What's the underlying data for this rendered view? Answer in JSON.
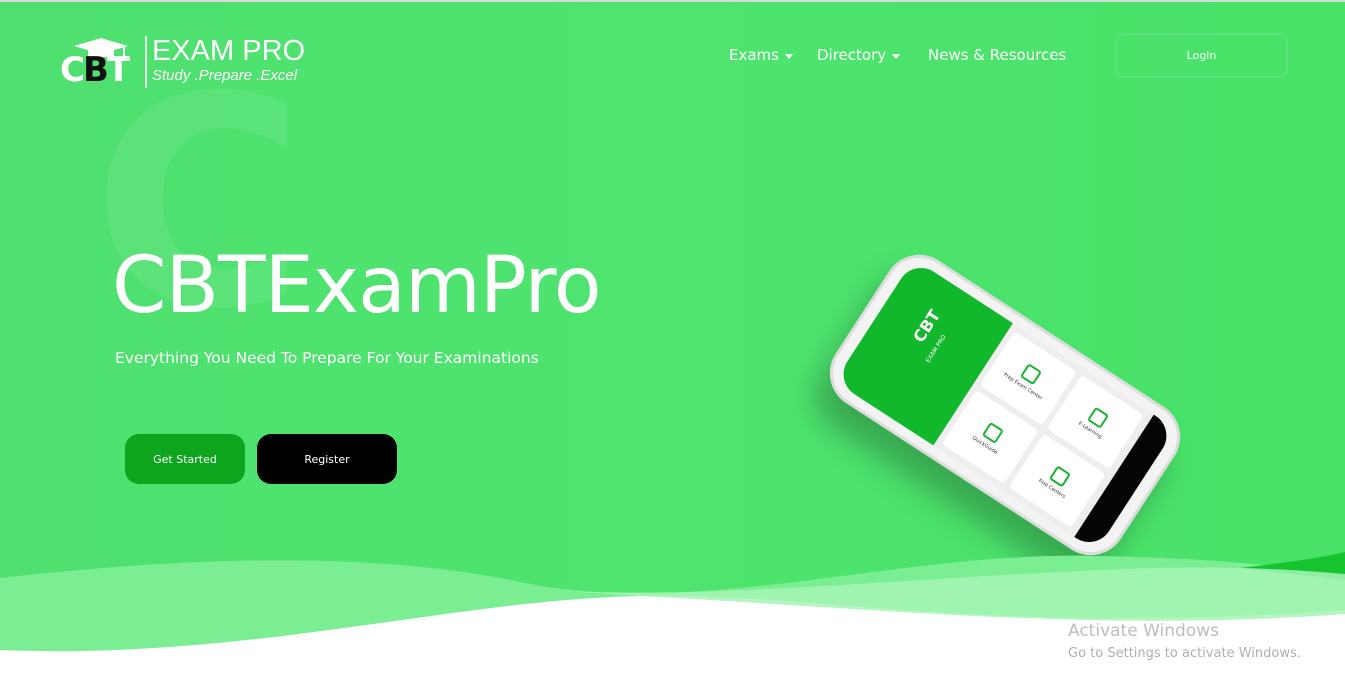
{
  "logo": {
    "mark": {
      "c": "C",
      "b": "B",
      "t": "T"
    },
    "title": "EXAM PRO",
    "tagline": "Study .Prepare .Excel"
  },
  "nav": {
    "exams": "Exams",
    "directory": "Directory",
    "news": "News & Resources",
    "login": "Login"
  },
  "hero": {
    "watermark_letter": "C",
    "title": "CBTExamPro",
    "subtitle": "Everything You Need To Prepare For Your Examinations",
    "get_started": "Get Started",
    "register": "Register"
  },
  "phone": {
    "logo": "CBT",
    "logo_sub": "EXAM PRO",
    "tiles": [
      "Prep Exam Center",
      "QuickGuide",
      "E-Learning",
      "Find Centers"
    ]
  },
  "windows": {
    "title": "Activate Windows",
    "subtitle": "Go to Settings to activate Windows."
  },
  "colors": {
    "background": "#4ee46f",
    "get_started": "#0da51e",
    "register": "#000000",
    "wave_light": "#7bee93"
  }
}
